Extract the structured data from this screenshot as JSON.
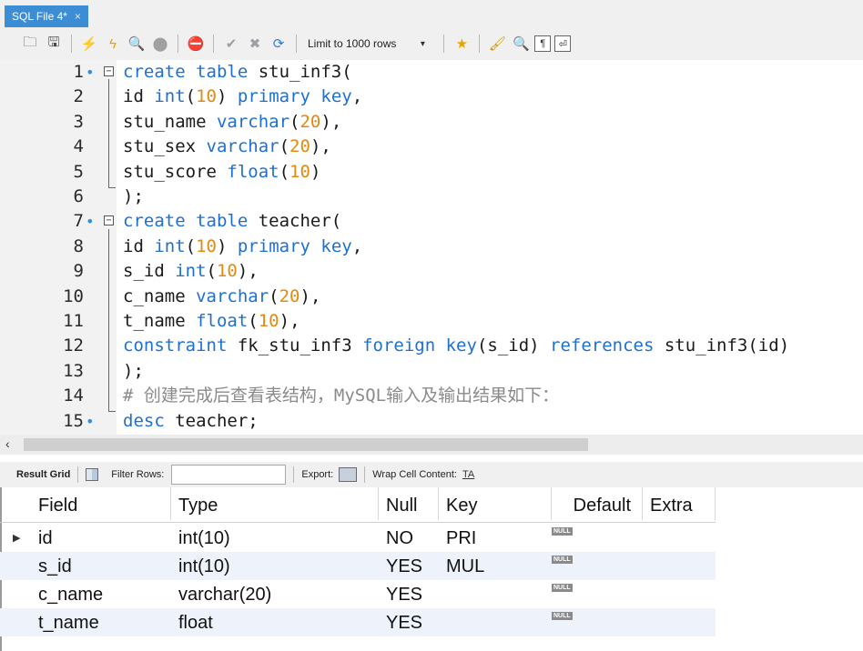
{
  "tab": {
    "title": "SQL File 4*",
    "close": "×"
  },
  "toolbar": {
    "limit_label": "Limit to 1000 rows"
  },
  "editor": {
    "lines": [
      {
        "n": "1",
        "dot": true,
        "fold": "open",
        "parts": [
          [
            "kw",
            "create table"
          ],
          [
            "t",
            " stu_inf3("
          ]
        ]
      },
      {
        "n": "2",
        "parts": [
          [
            "t",
            "id "
          ],
          [
            "kw",
            "int"
          ],
          [
            "t",
            "("
          ],
          [
            "num",
            "10"
          ],
          [
            "t",
            ") "
          ],
          [
            "kw",
            "primary key"
          ],
          [
            "t",
            ","
          ]
        ]
      },
      {
        "n": "3",
        "parts": [
          [
            "t",
            "stu_name "
          ],
          [
            "kw",
            "varchar"
          ],
          [
            "t",
            "("
          ],
          [
            "num",
            "20"
          ],
          [
            "t",
            "),"
          ]
        ]
      },
      {
        "n": "4",
        "parts": [
          [
            "t",
            "stu_sex "
          ],
          [
            "kw",
            "varchar"
          ],
          [
            "t",
            "("
          ],
          [
            "num",
            "20"
          ],
          [
            "t",
            "),"
          ]
        ]
      },
      {
        "n": "5",
        "parts": [
          [
            "t",
            "stu_score "
          ],
          [
            "kw",
            "float"
          ],
          [
            "t",
            "("
          ],
          [
            "num",
            "10"
          ],
          [
            "t",
            ")"
          ]
        ]
      },
      {
        "n": "6",
        "parts": [
          [
            "t",
            ");"
          ]
        ]
      },
      {
        "n": "7",
        "dot": true,
        "fold": "open",
        "parts": [
          [
            "kw",
            "create table"
          ],
          [
            "t",
            " teacher("
          ]
        ]
      },
      {
        "n": "8",
        "parts": [
          [
            "t",
            "id "
          ],
          [
            "kw",
            "int"
          ],
          [
            "t",
            "("
          ],
          [
            "num",
            "10"
          ],
          [
            "t",
            ") "
          ],
          [
            "kw",
            "primary key"
          ],
          [
            "t",
            ","
          ]
        ]
      },
      {
        "n": "9",
        "parts": [
          [
            "t",
            "s_id "
          ],
          [
            "kw",
            "int"
          ],
          [
            "t",
            "("
          ],
          [
            "num",
            "10"
          ],
          [
            "t",
            "),"
          ]
        ]
      },
      {
        "n": "10",
        "parts": [
          [
            "t",
            "c_name "
          ],
          [
            "kw",
            "varchar"
          ],
          [
            "t",
            "("
          ],
          [
            "num",
            "20"
          ],
          [
            "t",
            "),"
          ]
        ]
      },
      {
        "n": "11",
        "parts": [
          [
            "t",
            "t_name "
          ],
          [
            "kw",
            "float"
          ],
          [
            "t",
            "("
          ],
          [
            "num",
            "10"
          ],
          [
            "t",
            "),"
          ]
        ]
      },
      {
        "n": "12",
        "parts": [
          [
            "kw",
            "constraint"
          ],
          [
            "t",
            " fk_stu_inf3 "
          ],
          [
            "kw",
            "foreign key"
          ],
          [
            "t",
            "(s_id) "
          ],
          [
            "kw",
            "references"
          ],
          [
            "t",
            " stu_inf3(id)"
          ]
        ]
      },
      {
        "n": "13",
        "parts": [
          [
            "t",
            ");"
          ]
        ]
      },
      {
        "n": "14",
        "parts": [
          [
            "cm",
            "# 创建完成后查看表结构，MySQL输入及输出结果如下："
          ]
        ]
      },
      {
        "n": "15",
        "dot": true,
        "parts": [
          [
            "kw",
            "desc"
          ],
          [
            "t",
            " teacher;"
          ]
        ]
      }
    ]
  },
  "result_toolbar": {
    "result_grid": "Result Grid",
    "filter_rows": "Filter Rows:",
    "export": "Export:",
    "wrap": "Wrap Cell Content:",
    "wrap_icon": "TA"
  },
  "grid": {
    "headers": [
      "Field",
      "Type",
      "Null",
      "Key",
      "Default",
      "Extra"
    ],
    "rows": [
      {
        "Field": "id",
        "Type": "int(10)",
        "Null": "NO",
        "Key": "PRI",
        "Default": "NULL",
        "Extra": ""
      },
      {
        "Field": "s_id",
        "Type": "int(10)",
        "Null": "YES",
        "Key": "MUL",
        "Default": "NULL",
        "Extra": ""
      },
      {
        "Field": "c_name",
        "Type": "varchar(20)",
        "Null": "YES",
        "Key": "",
        "Default": "NULL",
        "Extra": ""
      },
      {
        "Field": "t_name",
        "Type": "float",
        "Null": "YES",
        "Key": "",
        "Default": "NULL",
        "Extra": ""
      }
    ],
    "selected_row_marker": "▶"
  },
  "colors": {
    "tab": "#3c8dd4",
    "keyword": "#1e70d0",
    "number": "#e08a10",
    "comment": "#8a8a8a",
    "row_alt": "#eef3fb"
  }
}
